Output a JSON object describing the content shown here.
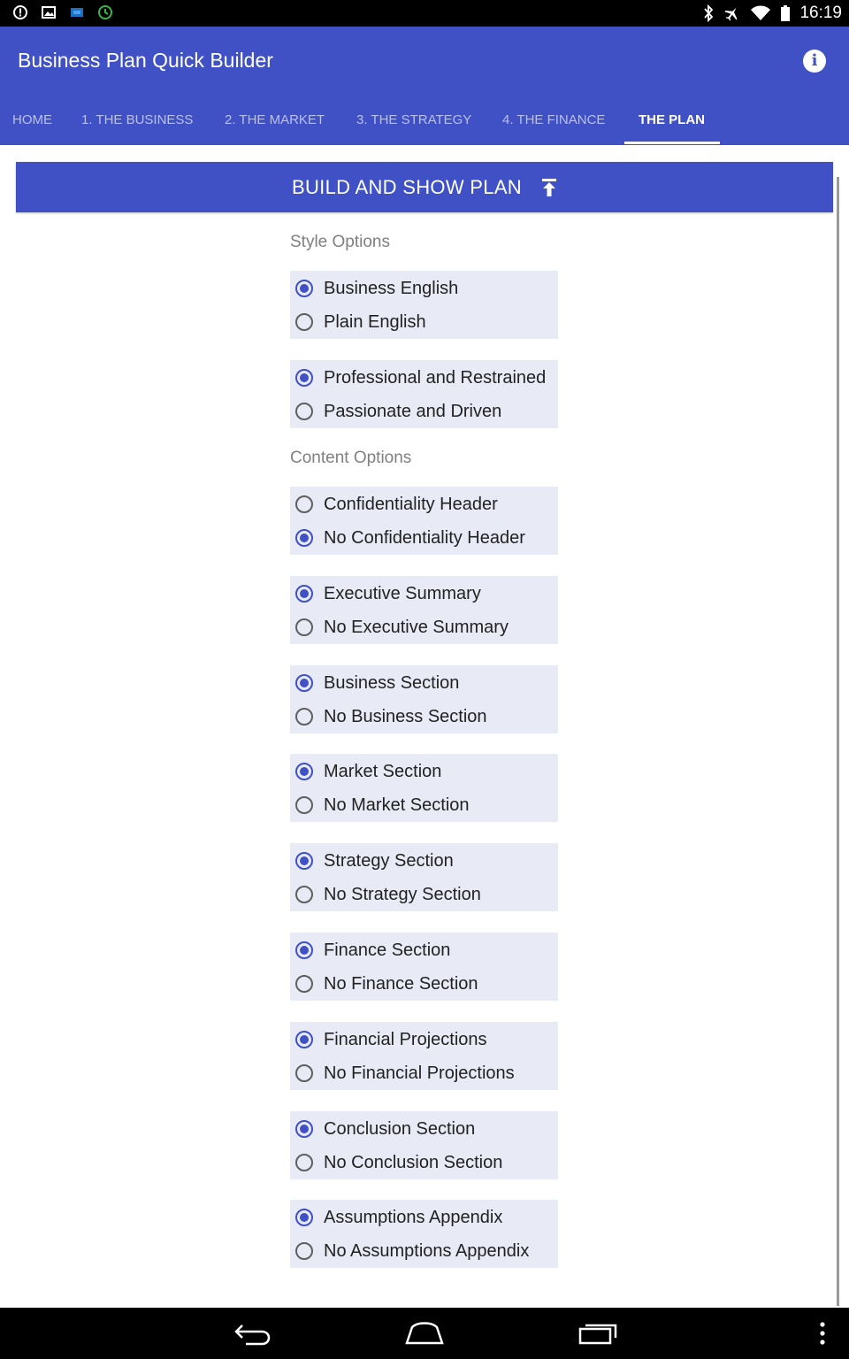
{
  "status_bar": {
    "time": "16:19",
    "left_icons": [
      "alert-icon",
      "image-icon",
      "app-icon",
      "timer-icon"
    ],
    "right_icons": [
      "bluetooth-icon",
      "airplane-icon",
      "wifi-icon",
      "battery-icon"
    ]
  },
  "app": {
    "title": "Business Plan Quick Builder",
    "accent": "#3f51c4"
  },
  "tabs": [
    {
      "label": "HOME",
      "active": false
    },
    {
      "label": "1. THE BUSINESS",
      "active": false
    },
    {
      "label": "2. THE MARKET",
      "active": false
    },
    {
      "label": "3. THE STRATEGY",
      "active": false
    },
    {
      "label": "4. THE FINANCE",
      "active": false
    },
    {
      "label": "THE PLAN",
      "active": true
    }
  ],
  "build_button": {
    "label": "BUILD AND SHOW PLAN"
  },
  "style_options": {
    "label": "Style Options",
    "groups": [
      {
        "options": [
          {
            "label": "Business English",
            "selected": true
          },
          {
            "label": "Plain English",
            "selected": false
          }
        ]
      },
      {
        "options": [
          {
            "label": "Professional and Restrained",
            "selected": true
          },
          {
            "label": "Passionate and Driven",
            "selected": false
          }
        ]
      }
    ]
  },
  "content_options": {
    "label": "Content Options",
    "groups": [
      {
        "options": [
          {
            "label": "Confidentiality Header",
            "selected": false
          },
          {
            "label": "No Confidentiality Header",
            "selected": true
          }
        ]
      },
      {
        "options": [
          {
            "label": "Executive Summary",
            "selected": true
          },
          {
            "label": "No Executive Summary",
            "selected": false
          }
        ]
      },
      {
        "options": [
          {
            "label": "Business Section",
            "selected": true
          },
          {
            "label": "No Business Section",
            "selected": false
          }
        ]
      },
      {
        "options": [
          {
            "label": "Market Section",
            "selected": true
          },
          {
            "label": "No Market Section",
            "selected": false
          }
        ]
      },
      {
        "options": [
          {
            "label": "Strategy Section",
            "selected": true
          },
          {
            "label": "No Strategy Section",
            "selected": false
          }
        ]
      },
      {
        "options": [
          {
            "label": "Finance Section",
            "selected": true
          },
          {
            "label": "No Finance Section",
            "selected": false
          }
        ]
      },
      {
        "options": [
          {
            "label": "Financial Projections",
            "selected": true
          },
          {
            "label": "No Financial Projections",
            "selected": false
          }
        ]
      },
      {
        "options": [
          {
            "label": "Conclusion Section",
            "selected": true
          },
          {
            "label": "No Conclusion Section",
            "selected": false
          }
        ]
      },
      {
        "options": [
          {
            "label": "Assumptions Appendix",
            "selected": true
          },
          {
            "label": "No Assumptions Appendix",
            "selected": false
          }
        ]
      }
    ]
  },
  "nav_bar": {
    "buttons": [
      "back-icon",
      "home-icon",
      "recents-icon",
      "overflow-menu-icon"
    ]
  }
}
